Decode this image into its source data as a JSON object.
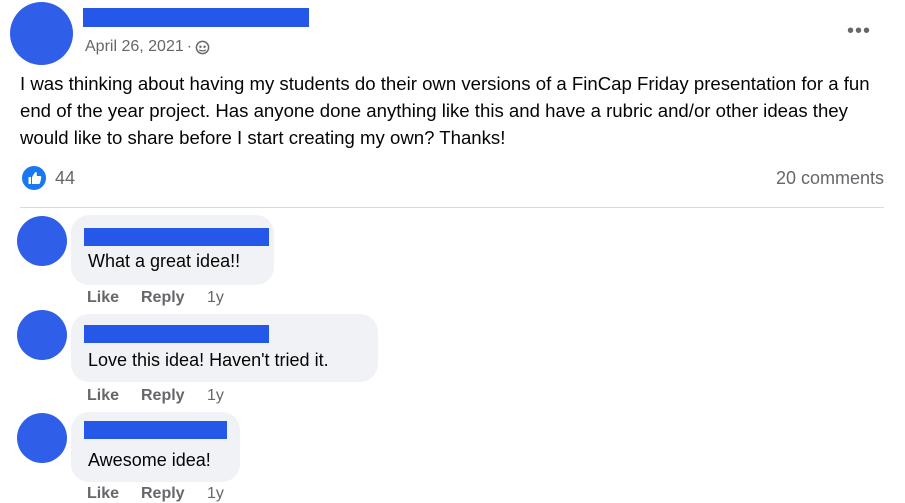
{
  "post": {
    "date": "April 26, 2021",
    "separator": "·",
    "body": "I was thinking about having my students do their own versions of a FinCap Friday presentation for a fun end of the year project. Has anyone done anything like this and have a rubric and/or other ideas they would like to share before I start creating my own? Thanks!",
    "more_label": "•••",
    "like_count": "44",
    "comments_label": "20 comments"
  },
  "comments": [
    {
      "text": "What a great idea!!",
      "like": "Like",
      "reply": "Reply",
      "age": "1y"
    },
    {
      "text": "Love this idea! Haven't tried it.",
      "like": "Like",
      "reply": "Reply",
      "age": "1y"
    },
    {
      "text": "Awesome idea!",
      "like": "Like",
      "reply": "Reply",
      "age": "1y"
    }
  ],
  "colors": {
    "redaction": "#2557e8",
    "like_blue": "#1877f2",
    "bubble": "#f0f2f5",
    "secondary_text": "#65676b"
  },
  "icons": {
    "audience": "globe-icon",
    "reaction": "thumbs-up-icon",
    "menu": "more-options-icon"
  }
}
